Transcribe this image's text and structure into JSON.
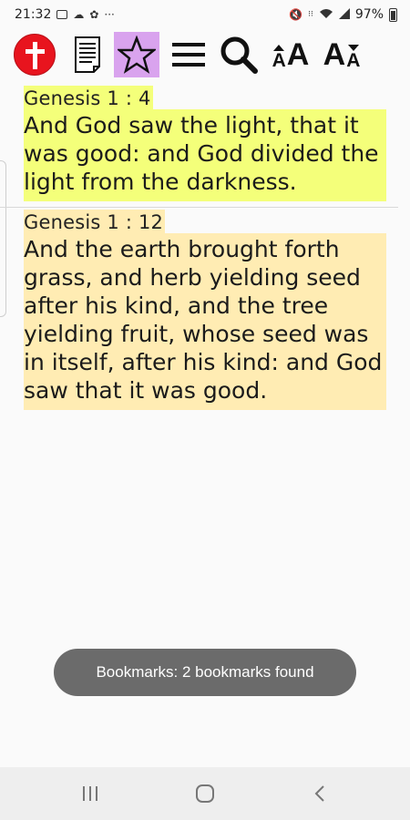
{
  "status_bar": {
    "time": "21:32",
    "dots": "···",
    "battery_text": "97%"
  },
  "toolbar": {
    "items": [
      {
        "name": "bible-cross-icon"
      },
      {
        "name": "document-icon"
      },
      {
        "name": "bookmark-star-icon",
        "active": true
      },
      {
        "name": "menu-icon"
      },
      {
        "name": "search-icon"
      },
      {
        "name": "font-size-increase-icon"
      },
      {
        "name": "font-size-decrease-icon"
      }
    ],
    "font_letter": "A",
    "active_color": "#d9a3ee",
    "cross_color": "#e8141e"
  },
  "bookmarks": [
    {
      "reference": "Genesis 1 : 4",
      "text": "And God saw the light, that it was good: and God divided the light from the darkness.",
      "highlight": "#f4ff7a"
    },
    {
      "reference": "Genesis 1 : 12",
      "text": "And the earth brought forth grass, and herb yielding seed after his kind, and the tree yielding fruit, whose seed was in itself, after his kind: and God saw that it was good.",
      "highlight": "#ffecb3"
    }
  ],
  "toast": {
    "message": "Bookmarks: 2 bookmarks found"
  },
  "nav_bar": {
    "items": [
      "recent-apps-icon",
      "home-icon",
      "back-icon"
    ]
  }
}
